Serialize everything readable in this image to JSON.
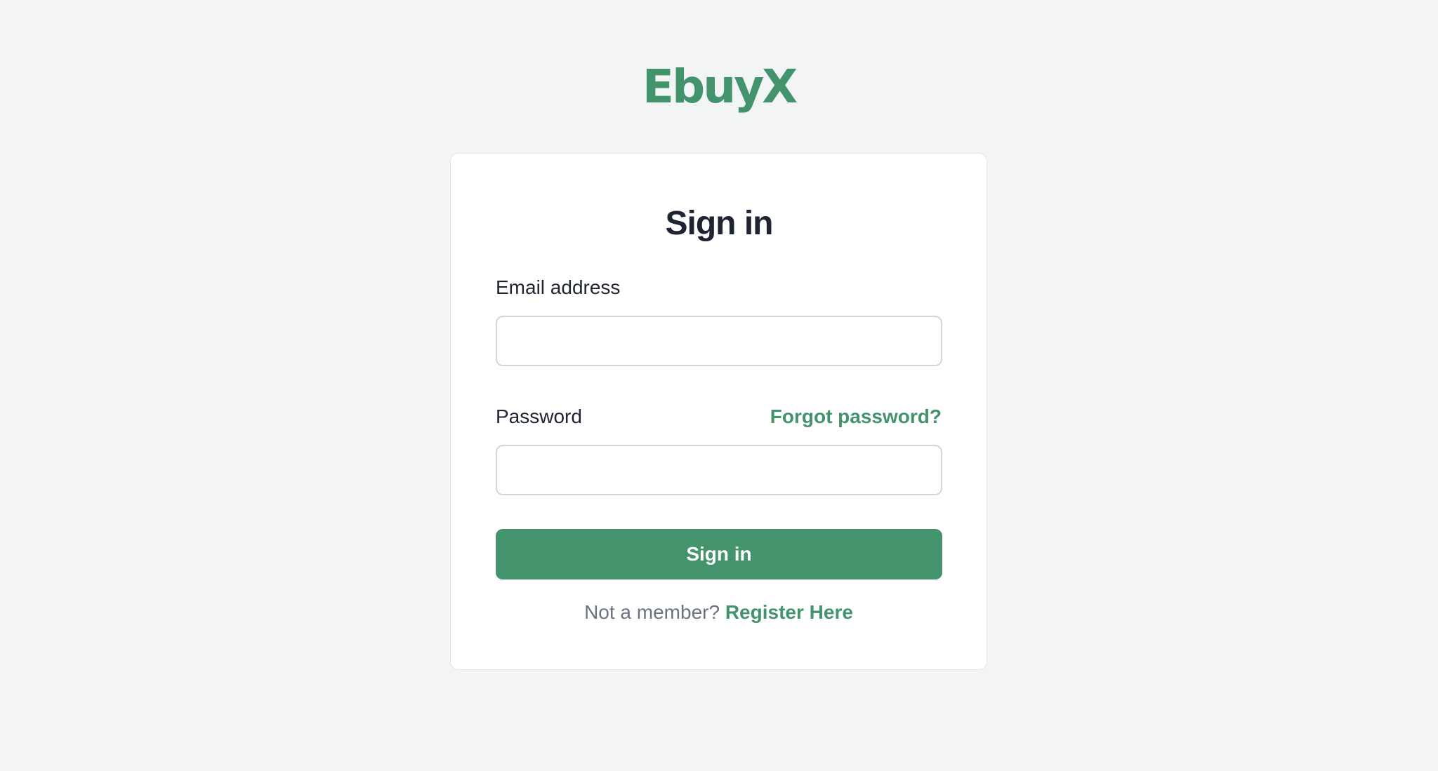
{
  "brand": {
    "logo_text": "EbuyX",
    "accent_color": "#43936c"
  },
  "form": {
    "title": "Sign in",
    "email": {
      "label": "Email address",
      "value": "",
      "placeholder": ""
    },
    "password": {
      "label": "Password",
      "value": "",
      "placeholder": "",
      "forgot_link": "Forgot password?"
    },
    "submit_label": "Sign in",
    "register_prompt": "Not a member?",
    "register_link": "Register Here"
  }
}
